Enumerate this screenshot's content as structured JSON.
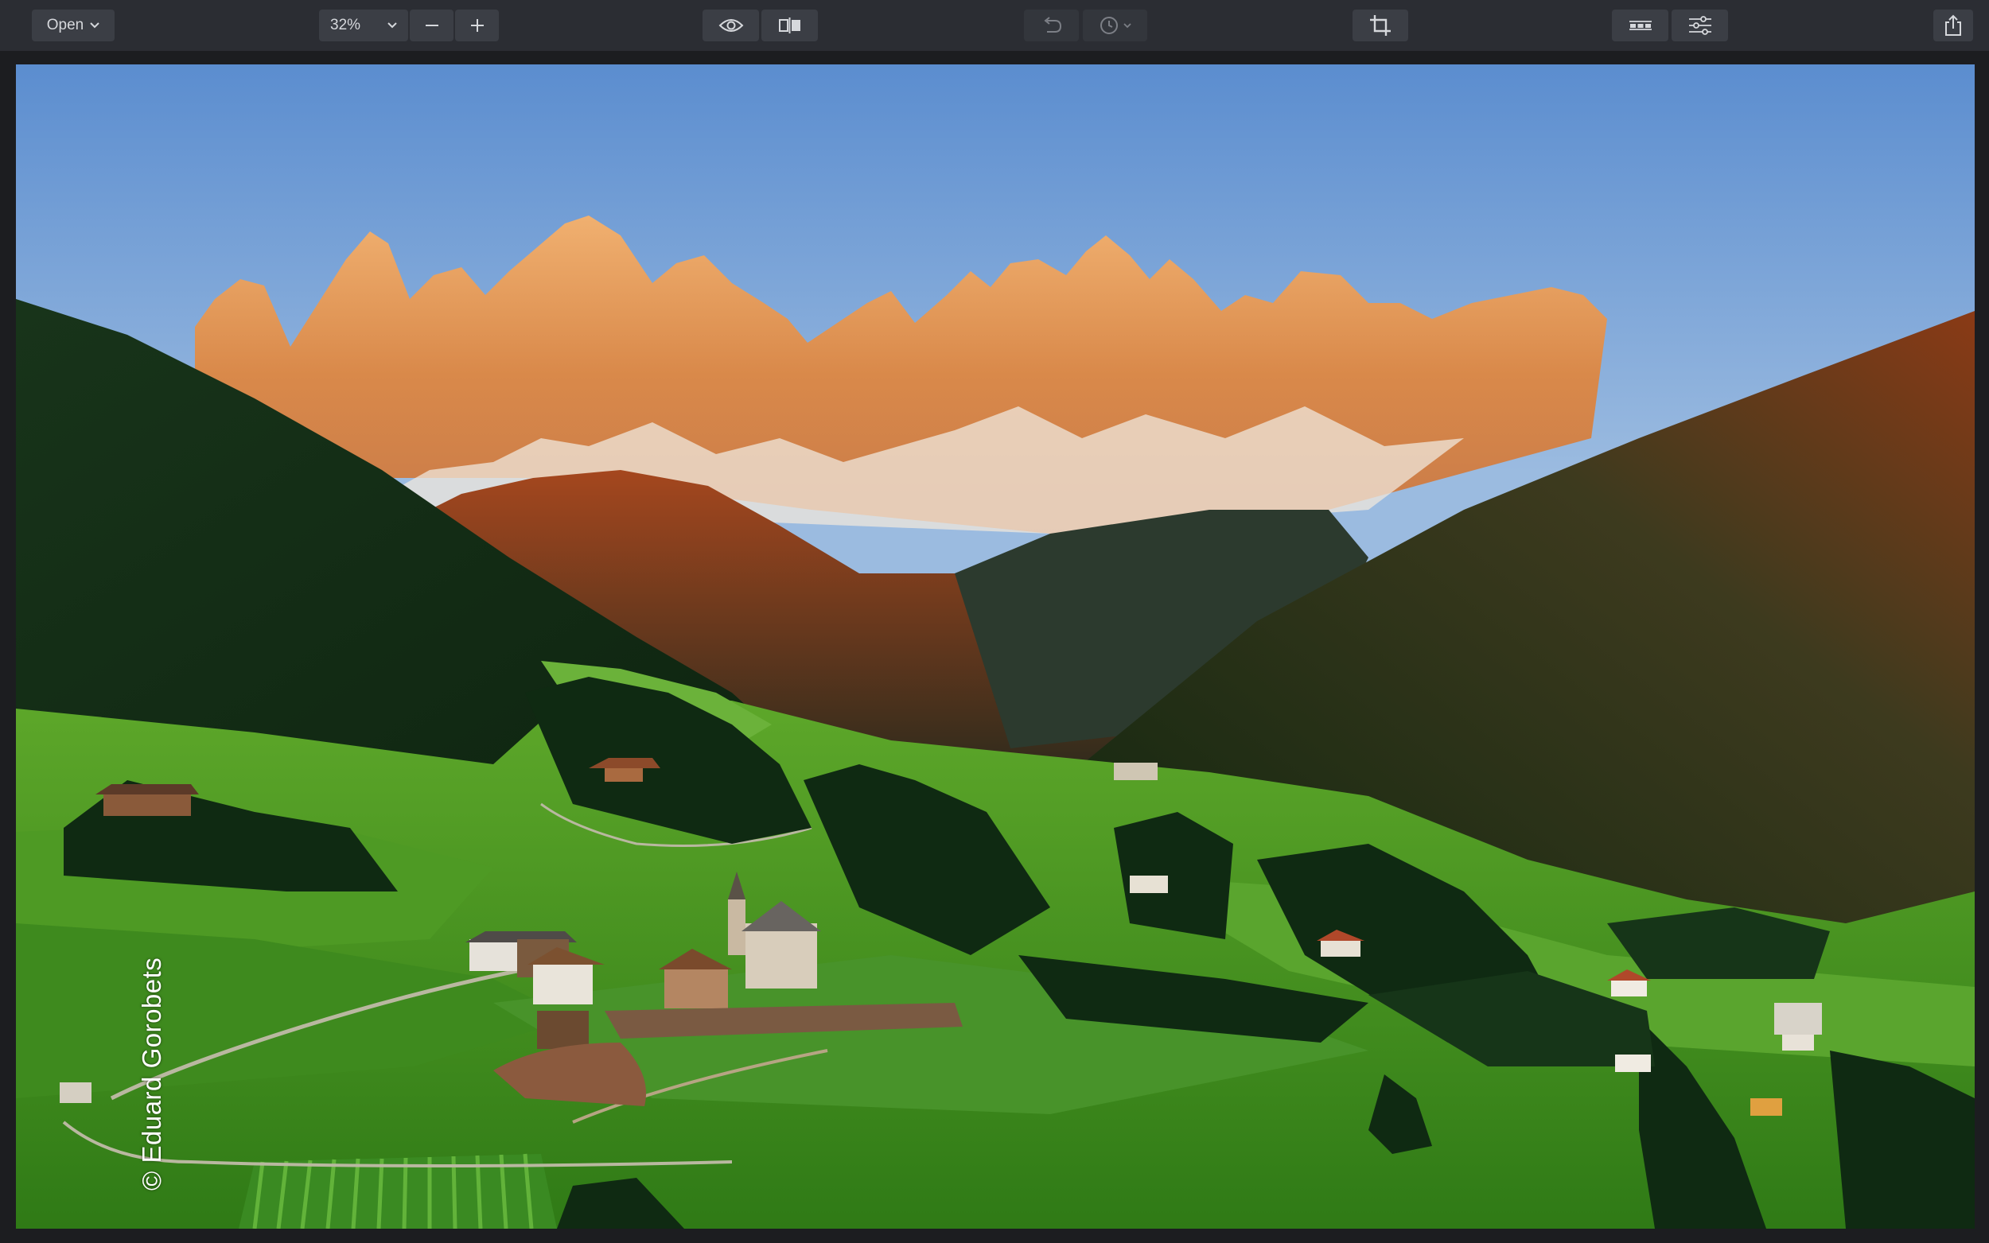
{
  "toolbar": {
    "open_label": "Open",
    "zoom_value": "32%",
    "icons": {
      "open_dropdown": "chevron-down-icon",
      "zoom_dropdown": "chevron-down-icon",
      "zoom_out": "minus-icon",
      "zoom_in": "plus-icon",
      "preview": "eye-icon",
      "compare": "split-view-icon",
      "undo": "undo-icon",
      "history": "clock-icon",
      "crop": "crop-icon",
      "filmstrip": "filmstrip-icon",
      "adjust": "sliders-icon",
      "share": "share-icon"
    }
  },
  "photo": {
    "watermark": "© Eduard Gorobets"
  },
  "colors": {
    "toolbar_bg": "#2b2d33",
    "button_bg": "#3b3e45",
    "icon": "#d6d8dc",
    "canvas_bg": "#1c1d20"
  }
}
